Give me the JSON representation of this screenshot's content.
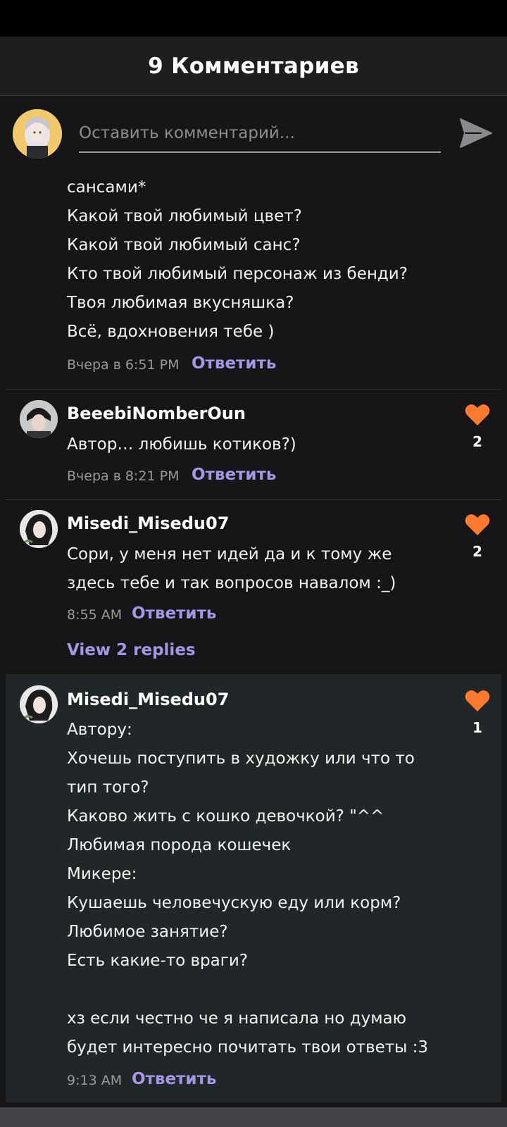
{
  "header": {
    "title": "9 Комментариев"
  },
  "composer": {
    "placeholder": "Оставить комментарий..."
  },
  "comments": [
    {
      "lines": [
        "сансами*",
        "Какой твой любимый цвет?",
        "Какой твой любимый санс?",
        "Кто твой любимый персонаж из бенди?",
        "Твоя любимая вкусняшка?",
        "Всё, вдохновения тебе )"
      ],
      "time": "Вчера в 6:51 PM",
      "reply_label": "Ответить"
    },
    {
      "username": "BeeebiNomberOun",
      "lines": [
        "Автор… любишь котиков?)"
      ],
      "time": "Вчера в 8:21 PM",
      "reply_label": "Ответить",
      "likes": "2"
    },
    {
      "username": "Misedi_Misedu07",
      "lines": [
        "Сори, у меня нет идей да и к тому же",
        "здесь тебе и так вопросов навалом :_)"
      ],
      "time": "8:55 AM",
      "reply_label": "Ответить",
      "likes": "2",
      "view_replies": "View 2 replies"
    }
  ],
  "reply": {
    "username": "Misedi_Misedu07",
    "lines": [
      "Автору:",
      "Хочешь поступить в художку или что то",
      "тип того?",
      "Каково жить с кошко девочкой? \"^^",
      "Любимая порода кошечек",
      "Микере:",
      "Кушаешь человечускую еду или корм?",
      "Любимое занятие?",
      "Есть какие-то враги?",
      "",
      "хз если честно че я написала но думаю",
      "будет интересно почитать твои ответы :3"
    ],
    "time": "9:13 AM",
    "reply_label": "Ответить",
    "likes": "1"
  },
  "colors": {
    "accent": "#a596e6",
    "heart": "#ff7a2f",
    "background": "#161518",
    "reply_panel": "#212629"
  }
}
